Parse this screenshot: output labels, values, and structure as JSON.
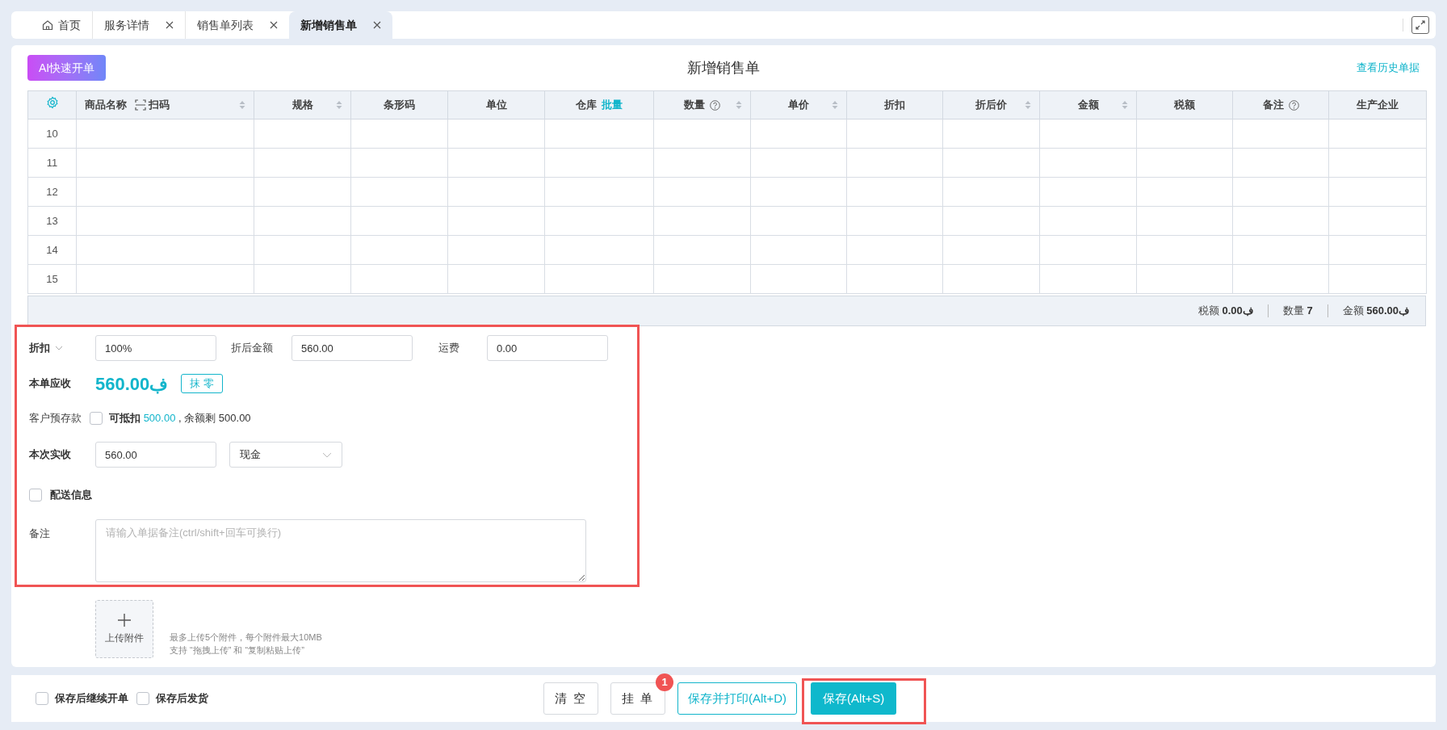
{
  "tabs": [
    {
      "label": "首页",
      "kind": "home",
      "closable": false,
      "selected": false
    },
    {
      "label": "服务详情",
      "kind": "page",
      "closable": true,
      "selected": false
    },
    {
      "label": "销售单列表",
      "kind": "page",
      "closable": true,
      "selected": false
    },
    {
      "label": "新增销售单",
      "kind": "page",
      "closable": true,
      "selected": true
    }
  ],
  "header": {
    "ai_button": "AI快速开单",
    "title": "新增销售单",
    "history_link": "查看历史单据"
  },
  "table": {
    "columns": [
      {
        "kind": "settings"
      },
      {
        "label": "商品名称",
        "scan": "扫码",
        "sortable": true
      },
      {
        "label": "规格",
        "sortable": true
      },
      {
        "label": "条形码",
        "sortable": false
      },
      {
        "label": "单位",
        "sortable": false
      },
      {
        "label": "仓库",
        "link": "批量",
        "sortable": false
      },
      {
        "label": "数量",
        "help": true,
        "sortable": true
      },
      {
        "label": "单价",
        "sortable": true
      },
      {
        "label": "折扣",
        "sortable": false
      },
      {
        "label": "折后价",
        "sortable": true
      },
      {
        "label": "金额",
        "sortable": true
      },
      {
        "label": "税额",
        "sortable": false
      },
      {
        "label": "备注",
        "help": true,
        "sortable": false
      },
      {
        "label": "生产企业",
        "sortable": false
      }
    ],
    "rows": [
      "10",
      "11",
      "12",
      "13",
      "14",
      "15"
    ],
    "summary": {
      "tax": {
        "label": "税额",
        "value": "0.00ڣ"
      },
      "quantity": {
        "label": "数量",
        "value": "7"
      },
      "amount": {
        "label": "金额",
        "value": "560.00ڣ"
      }
    }
  },
  "form": {
    "discount": {
      "label": "折扣",
      "value": "100%"
    },
    "discounted_amount": {
      "label": "折后金额",
      "value": "560.00"
    },
    "freight": {
      "label": "运费",
      "value": "0.00"
    },
    "receivable": {
      "label": "本单应收",
      "value": "560.00ڣ",
      "round_button": "抹 零"
    },
    "deposit": {
      "label": "客户预存款",
      "checked": false,
      "deductible_label": "可抵扣",
      "deductible": "500.00",
      "balance_label": ", 余额剩",
      "balance": "500.00"
    },
    "received": {
      "label": "本次实收",
      "value": "560.00",
      "method": "现金"
    },
    "delivery": {
      "label": "配送信息",
      "checked": false
    },
    "note": {
      "label": "备注",
      "placeholder": "请输入单据备注(ctrl/shift+回车可换行)"
    },
    "upload": {
      "label": "上传附件",
      "hints": [
        "最多上传5个附件，每个附件最大10MB",
        "支持 “拖拽上传” 和 “复制粘贴上传”"
      ]
    }
  },
  "footer": {
    "options": [
      {
        "label": "保存后继续开单",
        "checked": false
      },
      {
        "label": "保存后发货",
        "checked": false
      }
    ],
    "buttons": [
      {
        "label": "清 空",
        "kind": "plain"
      },
      {
        "label": "挂 单",
        "kind": "plain",
        "badge": "1"
      },
      {
        "label": "保存并打印(Alt+D)",
        "kind": "outline"
      },
      {
        "label": "保存(Alt+S)",
        "kind": "primary"
      }
    ]
  }
}
